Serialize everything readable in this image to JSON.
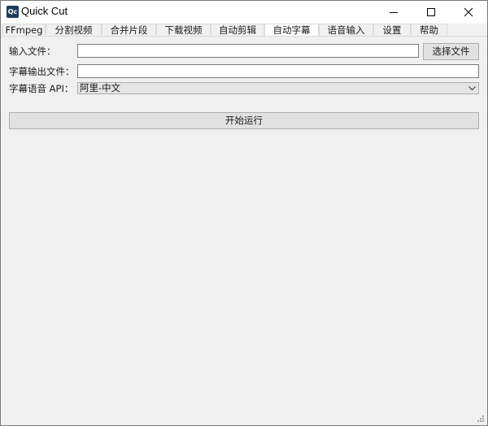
{
  "window": {
    "app_logo_text": "Qc",
    "title": "Quick Cut",
    "controls": {
      "minimize": "minimize-icon",
      "maximize": "maximize-icon",
      "close": "close-icon"
    }
  },
  "tabs": [
    {
      "label": "FFmpeg",
      "active": false
    },
    {
      "label": "分割视频",
      "active": false
    },
    {
      "label": "合并片段",
      "active": false
    },
    {
      "label": "下载视频",
      "active": false
    },
    {
      "label": "自动剪辑",
      "active": false
    },
    {
      "label": "自动字幕",
      "active": true
    },
    {
      "label": "语音输入",
      "active": false
    },
    {
      "label": "设置",
      "active": false
    },
    {
      "label": "帮助",
      "active": false
    }
  ],
  "form": {
    "input_file_label": "输入文件：",
    "input_file_value": "",
    "choose_file_button": "选择文件",
    "subtitle_output_label": "字幕输出文件：",
    "subtitle_output_value": "",
    "api_label": "字幕语音 API：",
    "api_selected": "阿里-中文",
    "run_button": "开始运行"
  },
  "colors": {
    "window_bg": "#f0f0f0",
    "titlebar_bg": "#ffffff",
    "button_bg": "#e1e1e1",
    "logo_bg": "#1d3c5c"
  }
}
